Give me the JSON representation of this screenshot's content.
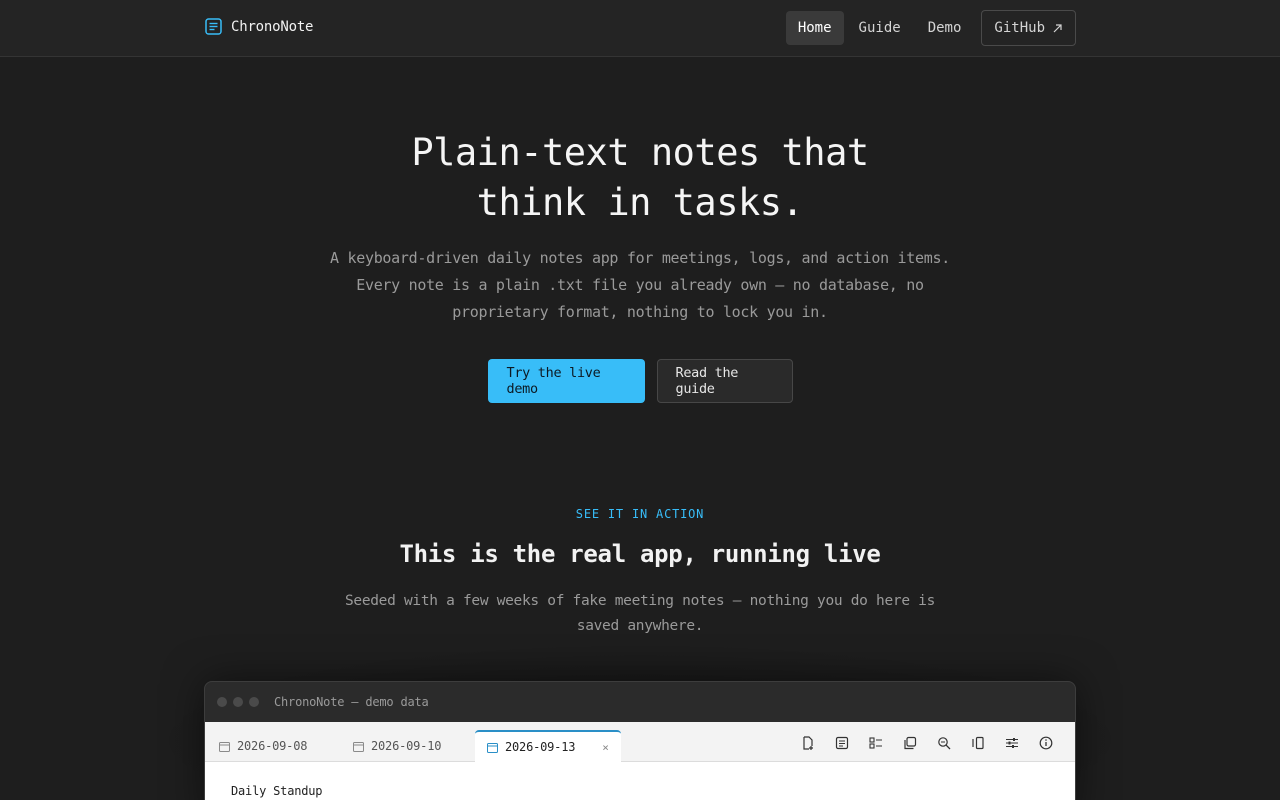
{
  "header": {
    "brand": "ChronoNote",
    "nav": [
      "Home",
      "Guide",
      "Demo"
    ],
    "github_label": "GitHub",
    "github_icon": "external-arrow-icon"
  },
  "hero": {
    "title_line1": "Plain-text notes that",
    "title_line2": "think in tasks.",
    "subtitle": "A keyboard-driven daily notes app for meetings, logs, and action items. Every note is a plain .txt file you already own — no database, no proprietary format, nothing to lock you in.",
    "primary_cta": "Try the live demo",
    "secondary_cta": "Read the guide"
  },
  "section": {
    "eyebrow": "SEE IT IN ACTION",
    "title": "This is the real app, running live",
    "subtitle": "Seeded with a few weeks of fake meeting notes — nothing you do here is saved anywhere."
  },
  "demo": {
    "window_title": "ChronoNote — demo data",
    "tabs": [
      {
        "label": "2026-09-08",
        "active": false
      },
      {
        "label": "2026-09-10",
        "active": false
      },
      {
        "label": "2026-09-13",
        "active": true
      }
    ],
    "toolbar_icons": [
      "new-file-icon",
      "note-icon",
      "tasks-icon",
      "copy-icon",
      "search-icon",
      "split-pane-icon",
      "settings-sliders-icon",
      "info-icon"
    ],
    "editor_first_line": "Daily Standup"
  },
  "colors": {
    "accent": "#38bdf8",
    "background": "#1e1e1e",
    "header_bg": "#242424"
  }
}
